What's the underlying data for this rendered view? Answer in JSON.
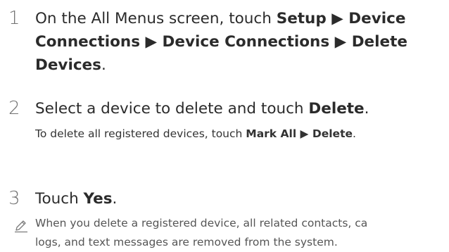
{
  "steps": [
    {
      "number": "1",
      "lines": [
        [
          "On the All Menus screen, touch ",
          {
            "b": "Setup"
          },
          " ▶ ",
          {
            "b": "Device"
          }
        ],
        [
          {
            "b": "Connections"
          },
          " ▶ ",
          {
            "b": "Device Connections"
          },
          " ▶ ",
          {
            "b": "Delete"
          }
        ],
        [
          {
            "b": "Devices"
          },
          "."
        ]
      ]
    },
    {
      "number": "2",
      "lines": [
        [
          "Select a device to delete and touch ",
          {
            "b": "Delete"
          },
          "."
        ]
      ],
      "sub": [
        "To delete all registered devices, touch ",
        {
          "b": "Mark All"
        },
        " ▶ ",
        {
          "b": "Delete"
        },
        "."
      ]
    },
    {
      "number": "3",
      "lines": [
        [
          "Touch ",
          {
            "b": "Yes"
          },
          "."
        ]
      ]
    }
  ],
  "note": {
    "icon": "pencil-note-icon",
    "lines": [
      "When you delete a registered device, all related contacts, ca",
      "logs, and text messages are removed from the system."
    ]
  }
}
